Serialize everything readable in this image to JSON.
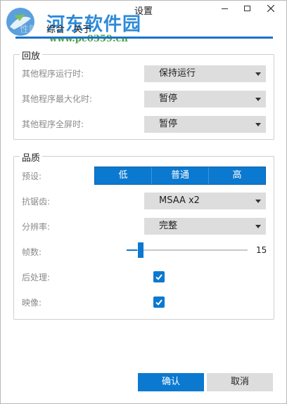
{
  "window": {
    "title": "设置",
    "controls": {
      "minimize": "minimize-icon",
      "maximize": "maximize-icon",
      "close": "close-icon"
    }
  },
  "watermark": {
    "title": "河东软件园",
    "url": "www.pc0359.cn"
  },
  "tabs": [
    {
      "label": "性能",
      "active": true
    },
    {
      "label": "综合",
      "active": false
    },
    {
      "label": "关于",
      "active": false
    }
  ],
  "playback": {
    "title": "回放",
    "rows": [
      {
        "label": "其他程序运行时:",
        "value": "保持运行"
      },
      {
        "label": "其他程序最大化时:",
        "value": "暂停"
      },
      {
        "label": "其他程序全屏时:",
        "value": "暂停"
      }
    ]
  },
  "quality": {
    "title": "品质",
    "preset": {
      "label": "预设:",
      "options": [
        "低",
        "普通",
        "高"
      ]
    },
    "antialias": {
      "label": "抗锯齿:",
      "value": "MSAA x2"
    },
    "resolution": {
      "label": "分辨率:",
      "value": "完整"
    },
    "fps": {
      "label": "帧数:",
      "value": "15",
      "fraction": 0.09
    },
    "postprocess": {
      "label": "后处理:",
      "checked": true
    },
    "reflection": {
      "label": "映像:",
      "checked": true
    }
  },
  "footer": {
    "ok_label": "确认",
    "cancel_label": "取消"
  },
  "colors": {
    "accent": "#0b79d0",
    "dropdown_bg": "#dddddd",
    "label_gray": "#8a8a8a",
    "watermark_blue": "#2e8ad8",
    "watermark_green": "#4aa13a"
  }
}
